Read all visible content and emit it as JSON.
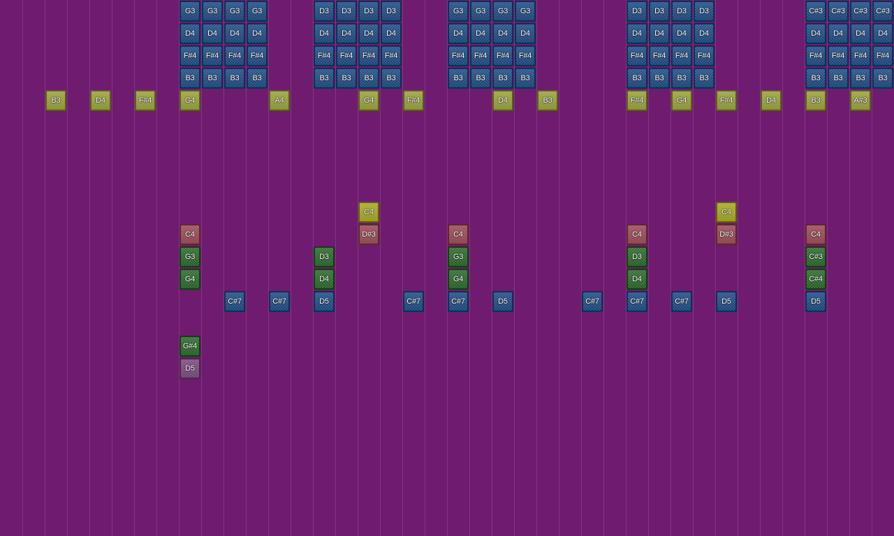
{
  "colors": {
    "background": "#6f1b6f",
    "grid_line": "rgba(255,255,255,0.13)",
    "blue": "#1d4c86",
    "blue_border": "#0e2f55",
    "olive": "#9aa23a",
    "olive_border": "#5a5e18",
    "yellow": "#a8a820",
    "yellow_border": "#5f5f10",
    "red": "#9b4a56",
    "red_border": "#5c2730",
    "green": "#2a6a2a",
    "green_border": "#133e13",
    "purple": "#7a4a7e",
    "purple_border": "#4a2450"
  },
  "notes": [
    {
      "col": 8,
      "row": 0,
      "label": "G3",
      "color": "blue"
    },
    {
      "col": 9,
      "row": 0,
      "label": "G3",
      "color": "blue"
    },
    {
      "col": 10,
      "row": 0,
      "label": "G3",
      "color": "blue"
    },
    {
      "col": 11,
      "row": 0,
      "label": "G3",
      "color": "blue"
    },
    {
      "col": 8,
      "row": 1,
      "label": "D4",
      "color": "blue"
    },
    {
      "col": 9,
      "row": 1,
      "label": "D4",
      "color": "blue"
    },
    {
      "col": 10,
      "row": 1,
      "label": "D4",
      "color": "blue"
    },
    {
      "col": 11,
      "row": 1,
      "label": "D4",
      "color": "blue"
    },
    {
      "col": 8,
      "row": 2,
      "label": "F#4",
      "color": "blue"
    },
    {
      "col": 9,
      "row": 2,
      "label": "F#4",
      "color": "blue"
    },
    {
      "col": 10,
      "row": 2,
      "label": "F#4",
      "color": "blue"
    },
    {
      "col": 11,
      "row": 2,
      "label": "F#4",
      "color": "blue"
    },
    {
      "col": 8,
      "row": 3,
      "label": "B3",
      "color": "blue"
    },
    {
      "col": 9,
      "row": 3,
      "label": "B3",
      "color": "blue"
    },
    {
      "col": 10,
      "row": 3,
      "label": "B3",
      "color": "blue"
    },
    {
      "col": 11,
      "row": 3,
      "label": "B3",
      "color": "blue"
    },
    {
      "col": 14,
      "row": 0,
      "label": "D3",
      "color": "blue"
    },
    {
      "col": 15,
      "row": 0,
      "label": "D3",
      "color": "blue"
    },
    {
      "col": 16,
      "row": 0,
      "label": "D3",
      "color": "blue"
    },
    {
      "col": 17,
      "row": 0,
      "label": "D3",
      "color": "blue"
    },
    {
      "col": 14,
      "row": 1,
      "label": "D4",
      "color": "blue"
    },
    {
      "col": 15,
      "row": 1,
      "label": "D4",
      "color": "blue"
    },
    {
      "col": 16,
      "row": 1,
      "label": "D4",
      "color": "blue"
    },
    {
      "col": 17,
      "row": 1,
      "label": "D4",
      "color": "blue"
    },
    {
      "col": 14,
      "row": 2,
      "label": "F#4",
      "color": "blue"
    },
    {
      "col": 15,
      "row": 2,
      "label": "F#4",
      "color": "blue"
    },
    {
      "col": 16,
      "row": 2,
      "label": "F#4",
      "color": "blue"
    },
    {
      "col": 17,
      "row": 2,
      "label": "F#4",
      "color": "blue"
    },
    {
      "col": 14,
      "row": 3,
      "label": "B3",
      "color": "blue"
    },
    {
      "col": 15,
      "row": 3,
      "label": "B3",
      "color": "blue"
    },
    {
      "col": 16,
      "row": 3,
      "label": "B3",
      "color": "blue"
    },
    {
      "col": 17,
      "row": 3,
      "label": "B3",
      "color": "blue"
    },
    {
      "col": 20,
      "row": 0,
      "label": "G3",
      "color": "blue"
    },
    {
      "col": 21,
      "row": 0,
      "label": "G3",
      "color": "blue"
    },
    {
      "col": 22,
      "row": 0,
      "label": "G3",
      "color": "blue"
    },
    {
      "col": 23,
      "row": 0,
      "label": "G3",
      "color": "blue"
    },
    {
      "col": 20,
      "row": 1,
      "label": "D4",
      "color": "blue"
    },
    {
      "col": 21,
      "row": 1,
      "label": "D4",
      "color": "blue"
    },
    {
      "col": 22,
      "row": 1,
      "label": "D4",
      "color": "blue"
    },
    {
      "col": 23,
      "row": 1,
      "label": "D4",
      "color": "blue"
    },
    {
      "col": 20,
      "row": 2,
      "label": "F#4",
      "color": "blue"
    },
    {
      "col": 21,
      "row": 2,
      "label": "F#4",
      "color": "blue"
    },
    {
      "col": 22,
      "row": 2,
      "label": "F#4",
      "color": "blue"
    },
    {
      "col": 23,
      "row": 2,
      "label": "F#4",
      "color": "blue"
    },
    {
      "col": 20,
      "row": 3,
      "label": "B3",
      "color": "blue"
    },
    {
      "col": 21,
      "row": 3,
      "label": "B3",
      "color": "blue"
    },
    {
      "col": 22,
      "row": 3,
      "label": "B3",
      "color": "blue"
    },
    {
      "col": 23,
      "row": 3,
      "label": "B3",
      "color": "blue"
    },
    {
      "col": 28,
      "row": 0,
      "label": "D3",
      "color": "blue"
    },
    {
      "col": 29,
      "row": 0,
      "label": "D3",
      "color": "blue"
    },
    {
      "col": 30,
      "row": 0,
      "label": "D3",
      "color": "blue"
    },
    {
      "col": 31,
      "row": 0,
      "label": "D3",
      "color": "blue"
    },
    {
      "col": 28,
      "row": 1,
      "label": "D4",
      "color": "blue"
    },
    {
      "col": 29,
      "row": 1,
      "label": "D4",
      "color": "blue"
    },
    {
      "col": 30,
      "row": 1,
      "label": "D4",
      "color": "blue"
    },
    {
      "col": 31,
      "row": 1,
      "label": "D4",
      "color": "blue"
    },
    {
      "col": 28,
      "row": 2,
      "label": "F#4",
      "color": "blue"
    },
    {
      "col": 29,
      "row": 2,
      "label": "F#4",
      "color": "blue"
    },
    {
      "col": 30,
      "row": 2,
      "label": "F#4",
      "color": "blue"
    },
    {
      "col": 31,
      "row": 2,
      "label": "F#4",
      "color": "blue"
    },
    {
      "col": 28,
      "row": 3,
      "label": "B3",
      "color": "blue"
    },
    {
      "col": 29,
      "row": 3,
      "label": "B3",
      "color": "blue"
    },
    {
      "col": 30,
      "row": 3,
      "label": "B3",
      "color": "blue"
    },
    {
      "col": 31,
      "row": 3,
      "label": "B3",
      "color": "blue"
    },
    {
      "col": 36,
      "row": 0,
      "label": "C#3",
      "color": "blue"
    },
    {
      "col": 37,
      "row": 0,
      "label": "C#3",
      "color": "blue"
    },
    {
      "col": 38,
      "row": 0,
      "label": "C#3",
      "color": "blue"
    },
    {
      "col": 39,
      "row": 0,
      "label": "C#3",
      "color": "blue"
    },
    {
      "col": 36,
      "row": 1,
      "label": "D4",
      "color": "blue"
    },
    {
      "col": 37,
      "row": 1,
      "label": "D4",
      "color": "blue"
    },
    {
      "col": 38,
      "row": 1,
      "label": "D4",
      "color": "blue"
    },
    {
      "col": 39,
      "row": 1,
      "label": "D4",
      "color": "blue"
    },
    {
      "col": 36,
      "row": 2,
      "label": "F#4",
      "color": "blue"
    },
    {
      "col": 37,
      "row": 2,
      "label": "F#4",
      "color": "blue"
    },
    {
      "col": 38,
      "row": 2,
      "label": "F#4",
      "color": "blue"
    },
    {
      "col": 39,
      "row": 2,
      "label": "F#4",
      "color": "blue"
    },
    {
      "col": 36,
      "row": 3,
      "label": "B3",
      "color": "blue"
    },
    {
      "col": 37,
      "row": 3,
      "label": "B3",
      "color": "blue"
    },
    {
      "col": 38,
      "row": 3,
      "label": "B3",
      "color": "blue"
    },
    {
      "col": 39,
      "row": 3,
      "label": "B3",
      "color": "blue"
    },
    {
      "col": 2,
      "row": 4,
      "label": "B3",
      "color": "olive"
    },
    {
      "col": 4,
      "row": 4,
      "label": "D4",
      "color": "olive"
    },
    {
      "col": 6,
      "row": 4,
      "label": "F#4",
      "color": "olive"
    },
    {
      "col": 8,
      "row": 4,
      "label": "G4",
      "color": "olive"
    },
    {
      "col": 12,
      "row": 4,
      "label": "A4",
      "color": "olive"
    },
    {
      "col": 16,
      "row": 4,
      "label": "G4",
      "color": "olive"
    },
    {
      "col": 18,
      "row": 4,
      "label": "F#4",
      "color": "olive"
    },
    {
      "col": 22,
      "row": 4,
      "label": "D4",
      "color": "olive"
    },
    {
      "col": 24,
      "row": 4,
      "label": "B3",
      "color": "olive"
    },
    {
      "col": 28,
      "row": 4,
      "label": "F#4",
      "color": "olive"
    },
    {
      "col": 30,
      "row": 4,
      "label": "G4",
      "color": "olive"
    },
    {
      "col": 32,
      "row": 4,
      "label": "F#4",
      "color": "olive"
    },
    {
      "col": 34,
      "row": 4,
      "label": "D4",
      "color": "olive"
    },
    {
      "col": 36,
      "row": 4,
      "label": "B3",
      "color": "olive"
    },
    {
      "col": 38,
      "row": 4,
      "label": "A#3",
      "color": "olive"
    },
    {
      "col": 16,
      "row": 9,
      "label": "C4",
      "color": "yellow"
    },
    {
      "col": 32,
      "row": 9,
      "label": "C4",
      "color": "yellow"
    },
    {
      "col": 8,
      "row": 10,
      "label": "C4",
      "color": "red"
    },
    {
      "col": 16,
      "row": 10,
      "label": "D#3",
      "color": "red"
    },
    {
      "col": 20,
      "row": 10,
      "label": "C4",
      "color": "red"
    },
    {
      "col": 28,
      "row": 10,
      "label": "C4",
      "color": "red"
    },
    {
      "col": 32,
      "row": 10,
      "label": "D#3",
      "color": "red"
    },
    {
      "col": 36,
      "row": 10,
      "label": "C4",
      "color": "red"
    },
    {
      "col": 8,
      "row": 11,
      "label": "G3",
      "color": "green"
    },
    {
      "col": 14,
      "row": 11,
      "label": "D3",
      "color": "green"
    },
    {
      "col": 20,
      "row": 11,
      "label": "G3",
      "color": "green"
    },
    {
      "col": 28,
      "row": 11,
      "label": "D3",
      "color": "green"
    },
    {
      "col": 36,
      "row": 11,
      "label": "C#3",
      "color": "green"
    },
    {
      "col": 8,
      "row": 12,
      "label": "G4",
      "color": "green"
    },
    {
      "col": 14,
      "row": 12,
      "label": "D4",
      "color": "green"
    },
    {
      "col": 20,
      "row": 12,
      "label": "G4",
      "color": "green"
    },
    {
      "col": 28,
      "row": 12,
      "label": "D4",
      "color": "green"
    },
    {
      "col": 36,
      "row": 12,
      "label": "C#4",
      "color": "green"
    },
    {
      "col": 10,
      "row": 13,
      "label": "C#7",
      "color": "blue"
    },
    {
      "col": 12,
      "row": 13,
      "label": "C#7",
      "color": "blue"
    },
    {
      "col": 14,
      "row": 13,
      "label": "D5",
      "color": "blue"
    },
    {
      "col": 18,
      "row": 13,
      "label": "C#7",
      "color": "blue"
    },
    {
      "col": 20,
      "row": 13,
      "label": "C#7",
      "color": "blue"
    },
    {
      "col": 22,
      "row": 13,
      "label": "D5",
      "color": "blue"
    },
    {
      "col": 26,
      "row": 13,
      "label": "C#7",
      "color": "blue"
    },
    {
      "col": 28,
      "row": 13,
      "label": "C#7",
      "color": "blue"
    },
    {
      "col": 30,
      "row": 13,
      "label": "C#7",
      "color": "blue"
    },
    {
      "col": 32,
      "row": 13,
      "label": "D5",
      "color": "blue"
    },
    {
      "col": 36,
      "row": 13,
      "label": "D5",
      "color": "blue"
    },
    {
      "col": 8,
      "row": 15,
      "label": "G#4",
      "color": "green"
    },
    {
      "col": 8,
      "row": 16,
      "label": "D5",
      "color": "purple"
    }
  ]
}
